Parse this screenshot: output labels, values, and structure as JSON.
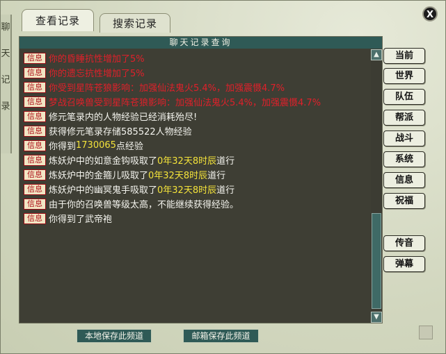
{
  "tabs": [
    {
      "label": "查看记录",
      "active": true
    },
    {
      "label": "搜索记录",
      "active": false
    }
  ],
  "panel_title": "聊天记录查询",
  "decor_text": [
    "聊",
    "天",
    "记",
    "录"
  ],
  "tag_label": "信息",
  "log": [
    {
      "parts": [
        {
          "text": "你的昏睡抗性增加了5%",
          "color": "red"
        }
      ]
    },
    {
      "parts": [
        {
          "text": "你的遗忘抗性增加了5%",
          "color": "red"
        }
      ]
    },
    {
      "parts": [
        {
          "text": "你受到星阵苍狼影响：加强仙法鬼火5.4%，加强震慑4.7%",
          "color": "red"
        }
      ]
    },
    {
      "parts": [
        {
          "text": "梦战召唤兽受到星阵苍狼影响：加强仙法鬼火5.4%，加强震慑4.7%",
          "color": "red"
        }
      ]
    },
    {
      "parts": [
        {
          "text": "修元笔录内的人物经验已经消耗殆尽!",
          "color": "white"
        }
      ]
    },
    {
      "parts": [
        {
          "text": "获得修元笔录存储585522人物经验",
          "color": "white"
        }
      ]
    },
    {
      "parts": [
        {
          "text": "你得到",
          "color": "white"
        },
        {
          "text": "1730065",
          "color": "yellow"
        },
        {
          "text": "点经验",
          "color": "white"
        }
      ]
    },
    {
      "parts": [
        {
          "text": "炼妖炉中的如意金钩吸取了",
          "color": "white"
        },
        {
          "text": "0年32天8时辰",
          "color": "yellow"
        },
        {
          "text": "道行",
          "color": "white"
        }
      ]
    },
    {
      "parts": [
        {
          "text": "炼妖炉中的金箍儿吸取了",
          "color": "white"
        },
        {
          "text": "0年32天8时辰",
          "color": "yellow"
        },
        {
          "text": "道行",
          "color": "white"
        }
      ]
    },
    {
      "parts": [
        {
          "text": "炼妖炉中的幽冥鬼手吸取了",
          "color": "white"
        },
        {
          "text": "0年32天8时辰",
          "color": "yellow"
        },
        {
          "text": "道行",
          "color": "white"
        }
      ]
    },
    {
      "parts": [
        {
          "text": "由于你的召唤兽等级太高，不能继续获得经验。",
          "color": "white"
        }
      ]
    },
    {
      "parts": [
        {
          "text": "你得到了武帝袍",
          "color": "white"
        }
      ]
    }
  ],
  "side_buttons": [
    "当前",
    "世界",
    "队伍",
    "帮派",
    "战斗",
    "系统",
    "信息",
    "祝福",
    "传音",
    "弹幕"
  ],
  "bottom_buttons": [
    "本地保存此频道",
    "邮箱保存此频道"
  ],
  "close_label": "X",
  "scroll": {
    "up": "▲",
    "down": "▼"
  }
}
